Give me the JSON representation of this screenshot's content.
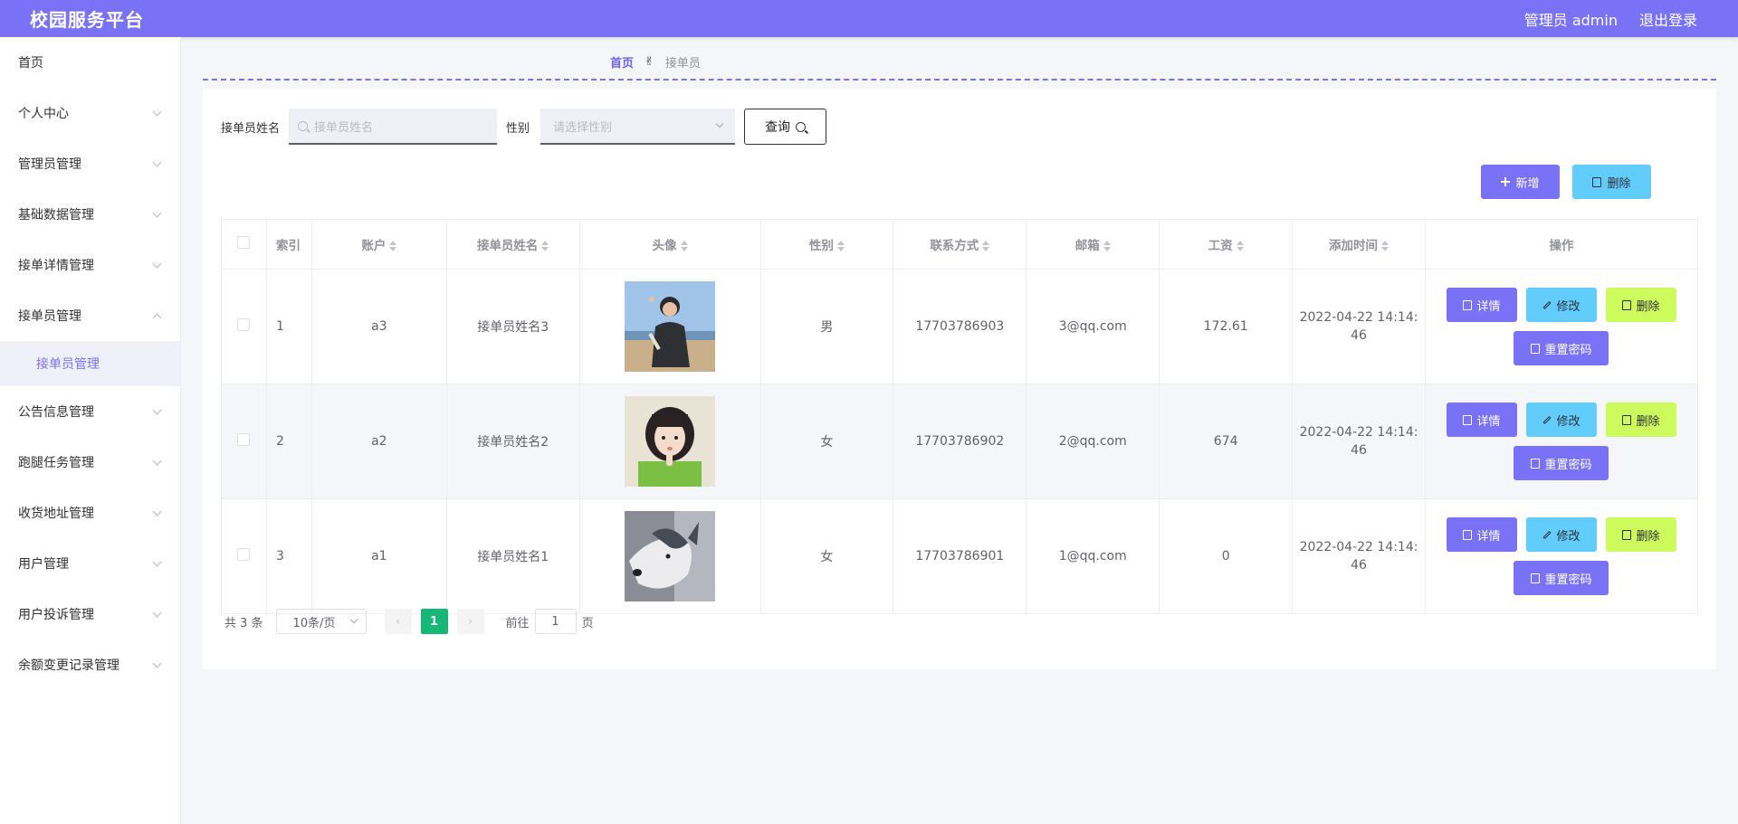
{
  "header": {
    "title": "校园服务平台",
    "user_label": "管理员 admin",
    "logout_label": "退出登录"
  },
  "sidebar": {
    "items": [
      {
        "label": "首页",
        "has_arrow": false
      },
      {
        "label": "个人中心",
        "has_arrow": true
      },
      {
        "label": "管理员管理",
        "has_arrow": true
      },
      {
        "label": "基础数据管理",
        "has_arrow": true
      },
      {
        "label": "接单详情管理",
        "has_arrow": true
      },
      {
        "label": "接单员管理",
        "has_arrow": true,
        "expanded": true
      },
      {
        "label": "公告信息管理",
        "has_arrow": true
      },
      {
        "label": "跑腿任务管理",
        "has_arrow": true
      },
      {
        "label": "收货地址管理",
        "has_arrow": true
      },
      {
        "label": "用户管理",
        "has_arrow": true
      },
      {
        "label": "用户投诉管理",
        "has_arrow": true
      },
      {
        "label": "余额变更记录管理",
        "has_arrow": true
      }
    ],
    "active_sub": "接单员管理"
  },
  "breadcrumb": {
    "home": "首页",
    "separator": "✌",
    "current": "接单员"
  },
  "search": {
    "name_label": "接单员姓名",
    "name_placeholder": "接单员姓名",
    "gender_label": "性别",
    "gender_placeholder": "请选择性别",
    "query_label": "查询"
  },
  "actions": {
    "add_label": "新增",
    "delete_label": "删除"
  },
  "table": {
    "headers": [
      "索引",
      "账户",
      "接单员姓名",
      "头像",
      "性别",
      "联系方式",
      "邮箱",
      "工资",
      "添加时间",
      "操作"
    ],
    "rows": [
      {
        "index": "1",
        "account": "a3",
        "name": "接单员姓名3",
        "gender": "男",
        "phone": "17703786903",
        "email": "3@qq.com",
        "salary": "172.61",
        "date": "2022-04-22 14:14:",
        "time": "46"
      },
      {
        "index": "2",
        "account": "a2",
        "name": "接单员姓名2",
        "gender": "女",
        "phone": "17703786902",
        "email": "2@qq.com",
        "salary": "674",
        "date": "2022-04-22 14:14:",
        "time": "46"
      },
      {
        "index": "3",
        "account": "a1",
        "name": "接单员姓名1",
        "gender": "女",
        "phone": "17703786901",
        "email": "1@qq.com",
        "salary": "0",
        "date": "2022-04-22 14:14:",
        "time": "46"
      }
    ],
    "ops": {
      "detail": "详情",
      "edit": "修改",
      "delete": "删除",
      "reset": "重置密码"
    }
  },
  "pager": {
    "total": "共 3 条",
    "page_size": "10条/页",
    "current_page": "1",
    "goto_prefix": "前往",
    "goto_value": "1",
    "goto_suffix": "页"
  },
  "colors": {
    "brand": "#7a72f6",
    "cyan": "#62cdfb",
    "lime": "#cdfa5c",
    "pager_active": "#16b777"
  }
}
